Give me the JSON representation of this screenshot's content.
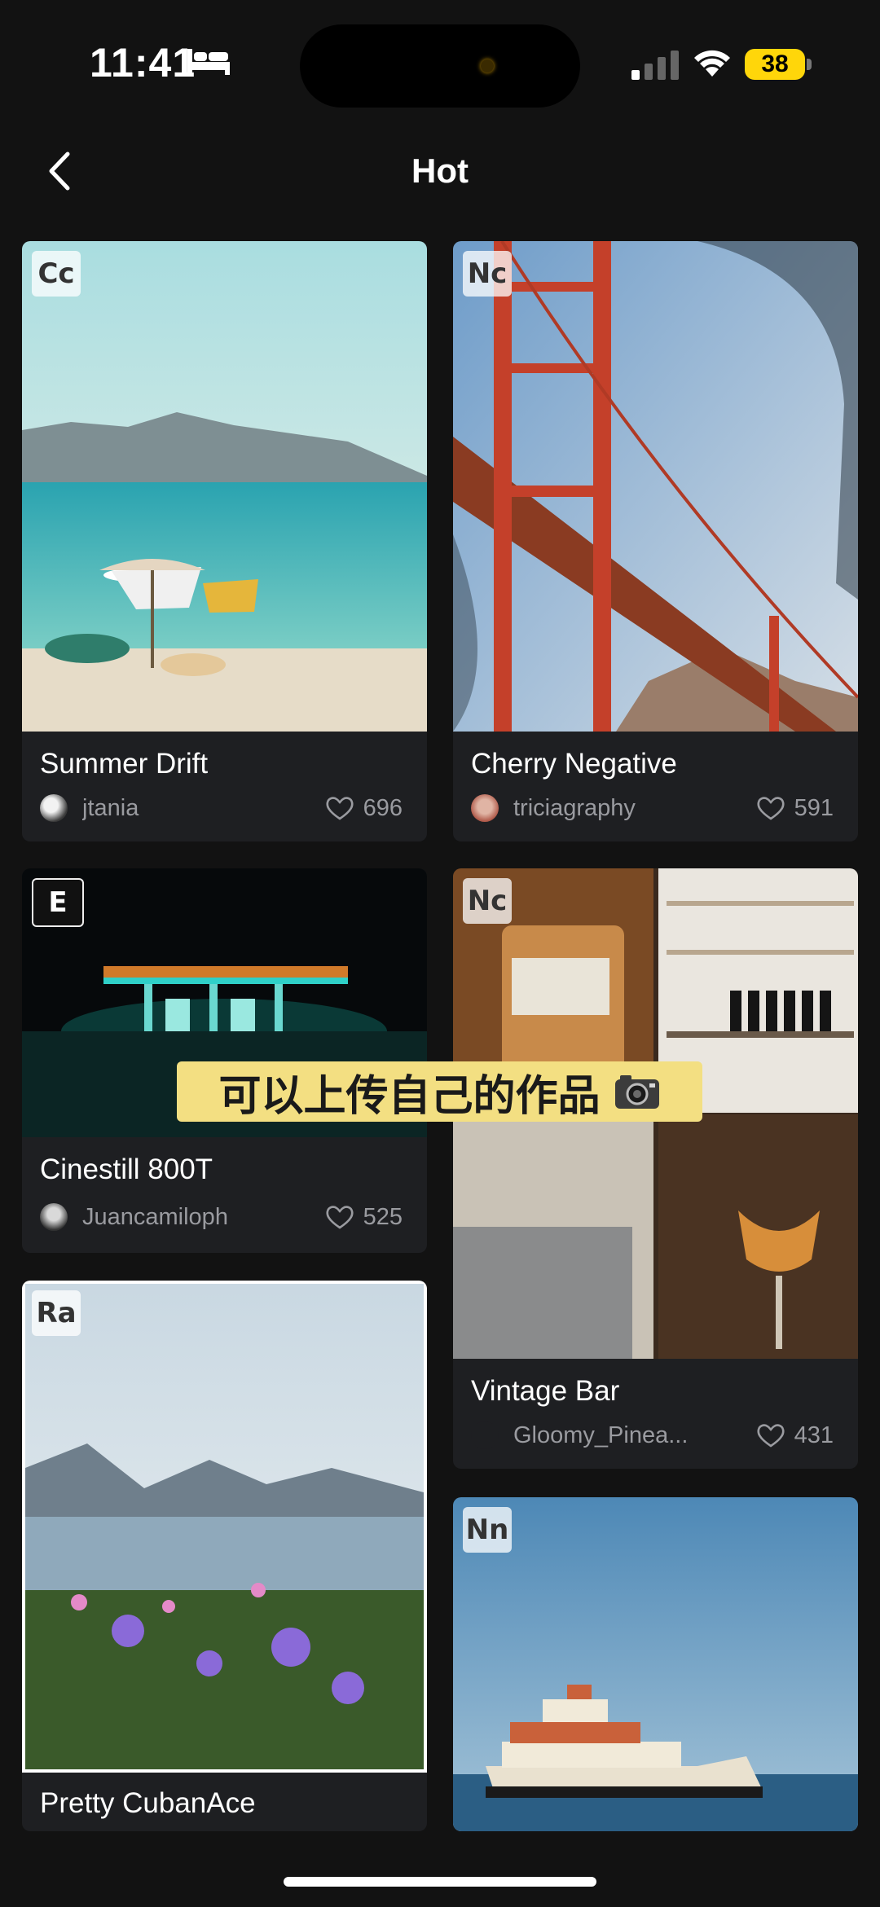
{
  "status": {
    "time": "11:41",
    "battery": "38"
  },
  "header": {
    "title": "Hot"
  },
  "caption": "可以上传自己的作品",
  "cards": [
    {
      "badge": "Cc",
      "name": "Summer Drift",
      "author": "jtania",
      "likes": "696"
    },
    {
      "badge": "Nc",
      "name": "Cherry Negative",
      "author": "triciagraphy",
      "likes": "591"
    },
    {
      "badge": "E",
      "name": "Cinestill 800T",
      "author": "Juancamiloph",
      "likes": "525"
    },
    {
      "badge": "Nc",
      "name": "Vintage Bar",
      "author": "Gloomy_Pinea...",
      "likes": "431"
    },
    {
      "badge": "Ra",
      "name": "Pretty CubanAce"
    },
    {
      "badge": "Nn"
    }
  ],
  "colors": {
    "background": "#121212",
    "card": "#1e1f22",
    "caption_bg": "#f3df82",
    "battery": "#ffd60a"
  }
}
